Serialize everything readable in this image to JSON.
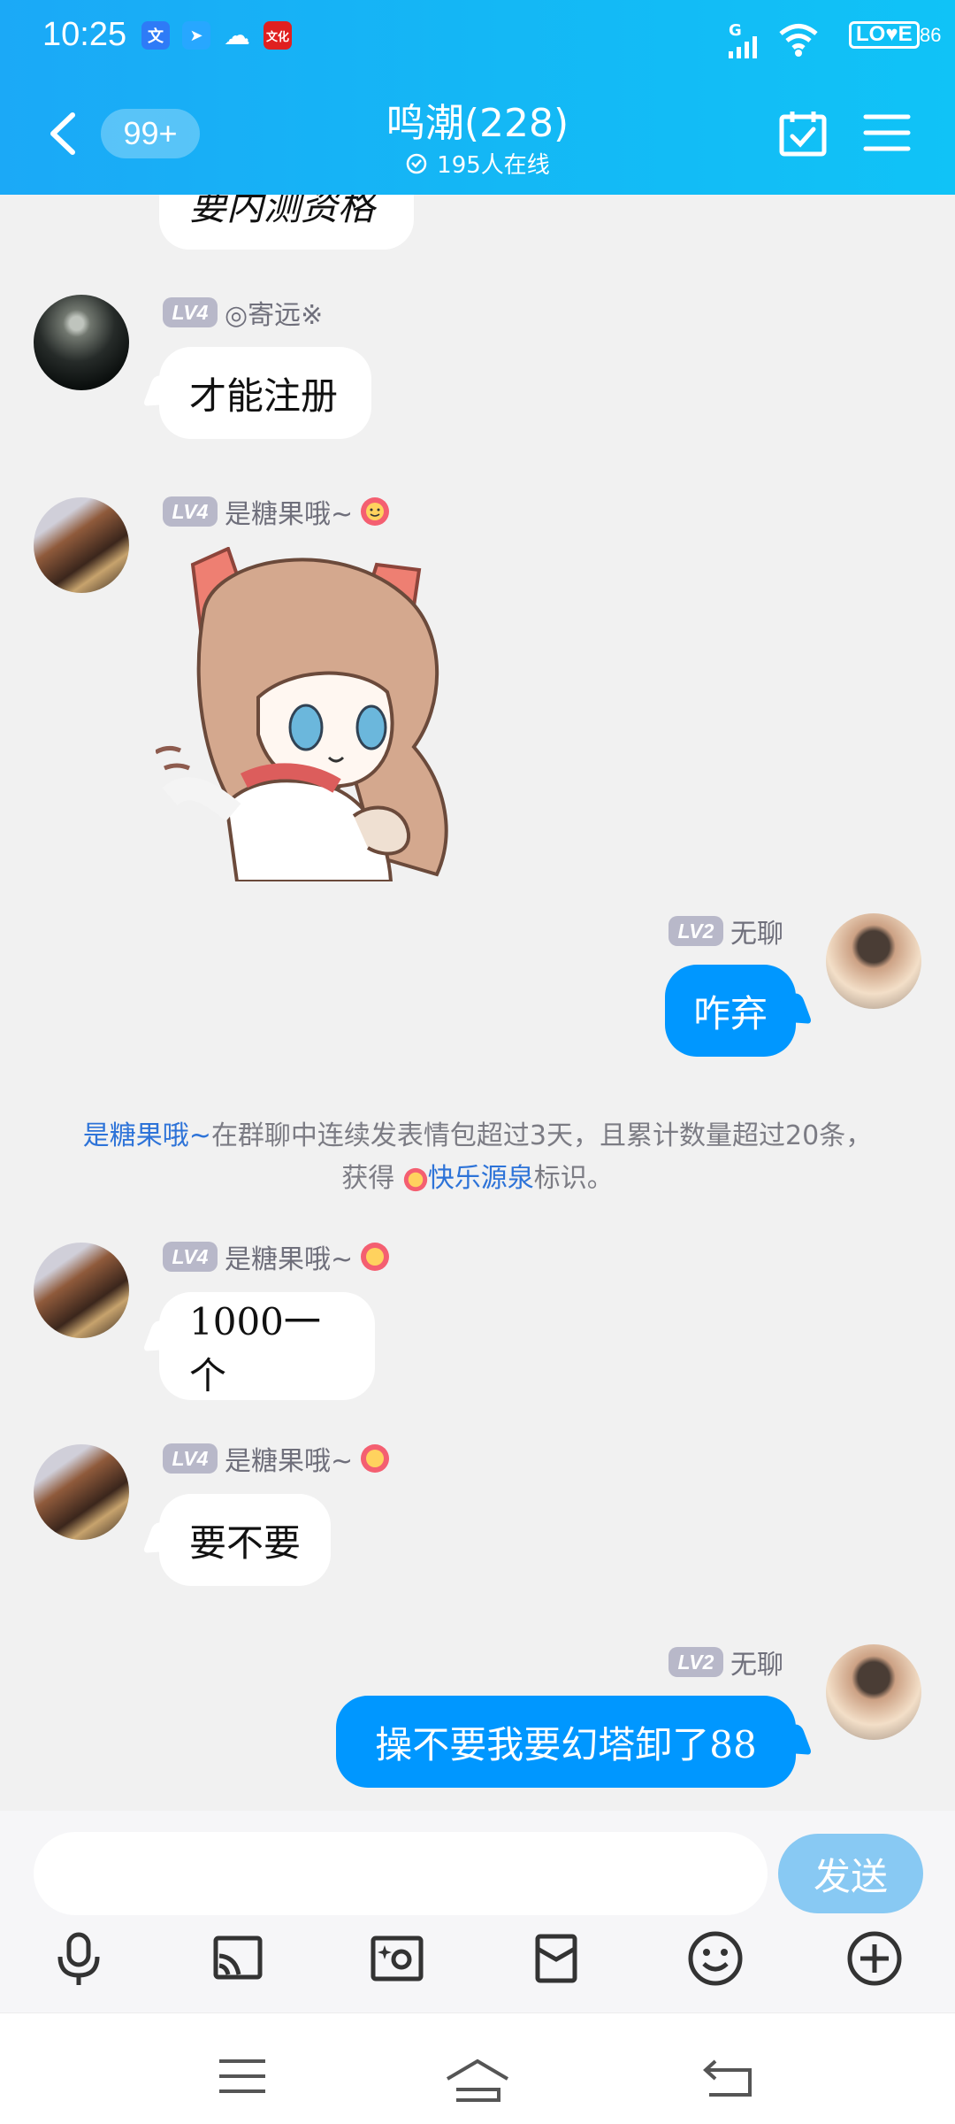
{
  "status": {
    "time": "10:25",
    "network": "G",
    "battery_label": "LO♥E",
    "battery_level": "86"
  },
  "header": {
    "unread_count": "99+",
    "title": "鸣潮(228)",
    "online": "195人在线"
  },
  "messages": [
    {
      "level": "LV4",
      "name": "◎寄远※",
      "text": "才能注册"
    },
    {
      "level": "LV4",
      "name": "是糖果哦~",
      "sticker": "anime-sticker"
    },
    {
      "level": "LV2",
      "name": "无聊",
      "text": "咋弃"
    },
    {
      "level": "LV4",
      "name": "是糖果哦~",
      "text": "1000一个"
    },
    {
      "level": "LV4",
      "name": "是糖果哦~",
      "text": "要不要"
    },
    {
      "level": "LV2",
      "name": "无聊",
      "text": "操不要我要幻塔卸了88"
    }
  ],
  "partial_top_text": "要内测资格",
  "system": {
    "name": "是糖果哦~",
    "line1": "在群聊中连续发表情包超过3天，且累计数量超过20条，",
    "prefix": "获得",
    "badge": "快乐源泉",
    "suffix": "标识。"
  },
  "input": {
    "placeholder": "",
    "send": "发送"
  },
  "icons": [
    "back-icon",
    "calendar-check-icon",
    "menu-icon",
    "microphone-icon",
    "screen-share-icon",
    "photo-icon",
    "red-packet-icon",
    "emoji-icon",
    "add-icon"
  ]
}
